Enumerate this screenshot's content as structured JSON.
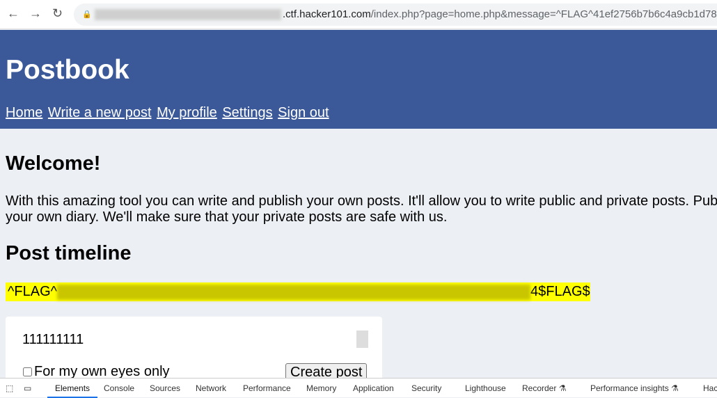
{
  "browser": {
    "url_visible": ".ctf.hacker101.com",
    "url_rest": "/index.php?page=home.php&message=^FLAG^41ef2756b7b6c4a9cb1d78"
  },
  "header": {
    "title": "Postbook",
    "nav": [
      "Home",
      "Write a new post",
      "My profile",
      "Settings",
      "Sign out"
    ]
  },
  "main": {
    "welcome": "Welcome!",
    "intro_line1": "With this amazing tool you can write and publish your own posts. It'll allow you to write public and private posts. Pub",
    "intro_line2": "your own diary. We'll make sure that your private posts are safe with us.",
    "timeline_title": "Post timeline",
    "flag_prefix": "^FLAG^",
    "flag_suffix": "4$FLAG$",
    "flag_bg": "#ffff00"
  },
  "form": {
    "textarea_value": "111111111",
    "private_label": "For my own eyes only",
    "submit": "Create post"
  },
  "devtools": {
    "tabs": [
      "Elements",
      "Console",
      "Sources",
      "Network",
      "Performance",
      "Memory",
      "Application",
      "Security",
      "Lighthouse",
      "Recorder ⚗",
      "Performance insights ⚗",
      "Hac"
    ],
    "active": "Elements"
  },
  "colors": {
    "header": "#3b5998",
    "background": "#eceff4"
  }
}
